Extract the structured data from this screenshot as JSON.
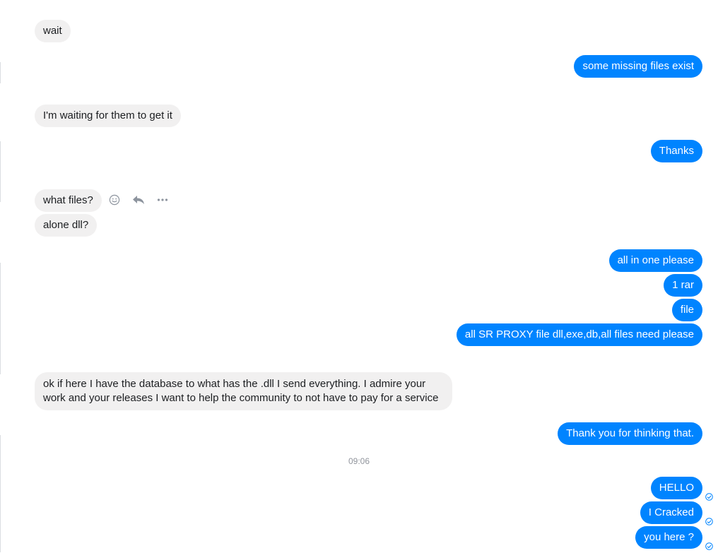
{
  "messages": [
    {
      "text": "wait"
    },
    {
      "text": "some missing files exist"
    },
    {
      "text": "I'm waiting for them to get it"
    },
    {
      "text": "Thanks"
    },
    {
      "text": "what files?"
    },
    {
      "text": "alone dll?"
    },
    {
      "text": "all in one please"
    },
    {
      "text": "1 rar"
    },
    {
      "text": "file"
    },
    {
      "text": "all SR PROXY file dll,exe,db,all files need please"
    },
    {
      "text": "ok if here I have the database to what has the .dll I send everything. I admire your work and your releases I want to help the community to not have to pay for a service"
    },
    {
      "text": "Thank you for thinking that."
    },
    {
      "text": "HELLO"
    },
    {
      "text": "I Cracked"
    },
    {
      "text": "you here ?"
    }
  ],
  "timestamp": "09:06",
  "colors": {
    "outgoing": "#0084ff",
    "incoming": "#f1f0f0",
    "action_icon": "#8d949e",
    "seen_icon": "#0084ff"
  },
  "icons": [
    "react-icon",
    "reply-icon",
    "more-icon",
    "seen-check-icon"
  ]
}
